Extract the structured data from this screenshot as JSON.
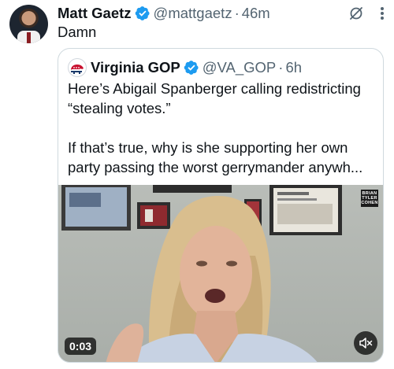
{
  "tweet": {
    "author_name": "Matt Gaetz",
    "handle": "@mattgaetz",
    "separator": "·",
    "time": "46m",
    "text": "Damn"
  },
  "quoted": {
    "author_name": "Virginia GOP",
    "handle": "@VA_GOP",
    "separator": "·",
    "time": "6h",
    "text_para1": "Here’s Abigail Spanberger calling redistricting “stealing votes.”",
    "text_para2": "If that’s true, why is she supporting her own party passing the worst gerrymander anywh..."
  },
  "video": {
    "duration": "0:03",
    "watermark_lines": [
      "BRIAN",
      "TYLER",
      "COHEN"
    ]
  },
  "icons": {
    "verified": "verified-badge-icon",
    "grok": "grok-icon",
    "more": "more-vertical-icon",
    "mute": "volume-muted-icon"
  },
  "colors": {
    "text": "#0f1419",
    "secondary": "#536471",
    "verified": "#1d9bf0",
    "border": "#cfd9de"
  }
}
